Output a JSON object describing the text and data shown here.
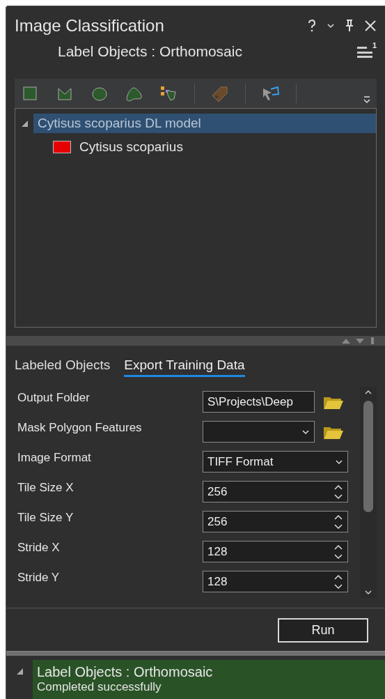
{
  "window": {
    "title": "Image Classification",
    "subtitle": "Label Objects : Orthomosaic",
    "menu_badge": "1"
  },
  "tree": [
    {
      "label": "Cytisus scoparius DL model",
      "selected": true,
      "expanded": true,
      "children": [
        {
          "label": "Cytisus scoparius",
          "selected": false,
          "color": "#e60000"
        }
      ]
    }
  ],
  "tabs": [
    {
      "label": "Labeled Objects",
      "selected": false
    },
    {
      "label": "Export Training Data",
      "selected": true
    }
  ],
  "fields": [
    {
      "kind": "text",
      "label": "Output Folder",
      "value": "S\\Projects\\Deep",
      "browse": true
    },
    {
      "kind": "combo",
      "label": "Mask Polygon Features",
      "browse": true
    },
    {
      "kind": "combo",
      "label": "Image Format",
      "value": "TIFF Format",
      "browse": false
    },
    {
      "kind": "spinner",
      "label": "Tile Size X",
      "value": "256",
      "browse": false
    },
    {
      "kind": "spinner",
      "label": "Tile Size Y",
      "value": "256",
      "browse": false
    },
    {
      "kind": "spinner",
      "label": "Stride X",
      "value": "128",
      "browse": false
    },
    {
      "kind": "spinner",
      "label": "Stride Y",
      "value": "128",
      "browse": false
    }
  ],
  "run_button": "Run",
  "status": {
    "title": "Label Objects : Orthomosaic",
    "message": "Completed successfully"
  }
}
